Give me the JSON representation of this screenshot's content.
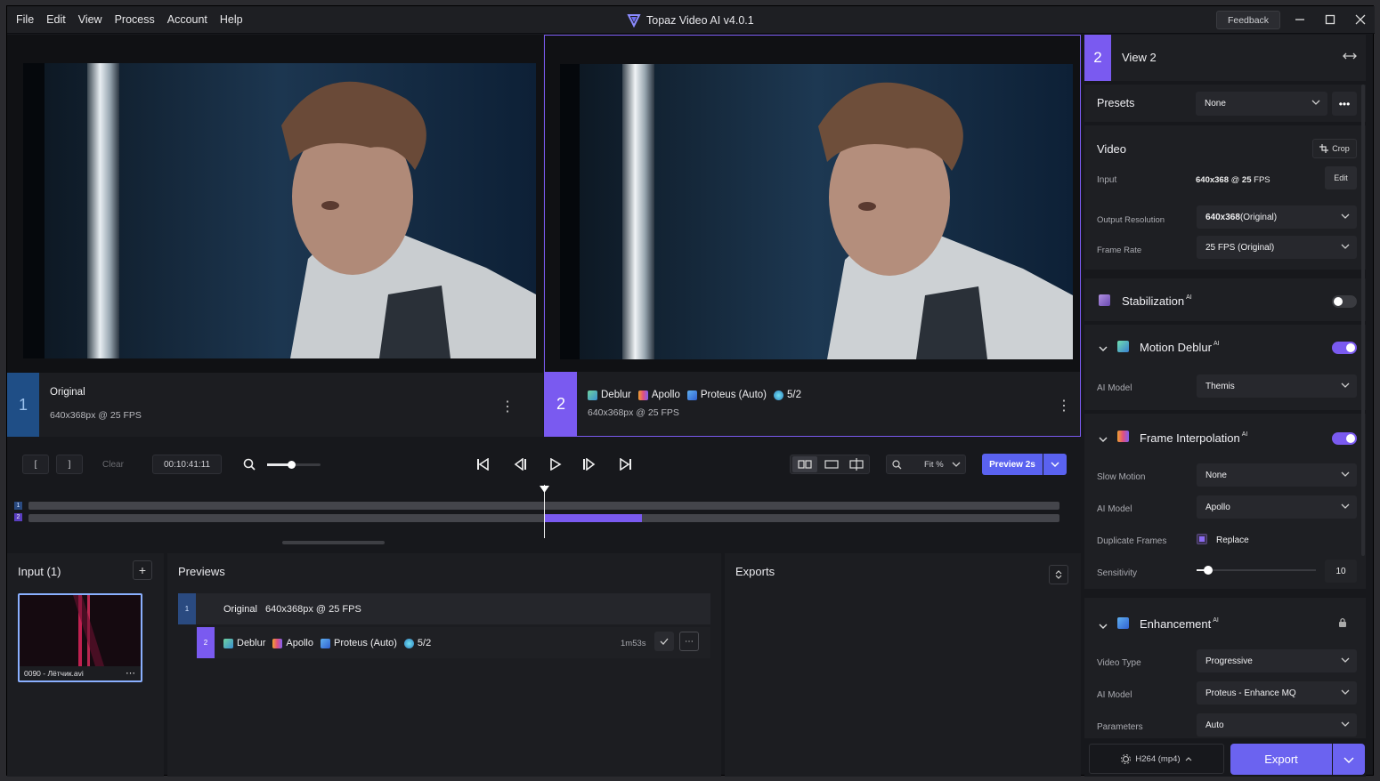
{
  "menu": [
    "File",
    "Edit",
    "View",
    "Process",
    "Account",
    "Help"
  ],
  "app_title": "Topaz Video AI  v4.0.1",
  "feedback_label": "Feedback",
  "viewer1": {
    "number": "1",
    "title": "Original",
    "meta": "640x368px @ 25 FPS"
  },
  "viewer2": {
    "number": "2",
    "tags": [
      "Deblur",
      "Apollo",
      "Proteus (Auto)",
      "5/2"
    ],
    "meta": "640x368px @ 25 FPS"
  },
  "transport": {
    "in_mark": "[",
    "out_mark": "]",
    "clear_label": "Clear",
    "timecode": "00:10:41:11",
    "fit_label": "Fit %",
    "preview_label": "Preview 2s",
    "track1": "1",
    "track2": "2",
    "zoom_level": 0.45,
    "playhead_fraction": 0.5,
    "preview_range": [
      0.5,
      0.595
    ]
  },
  "input_panel": {
    "title": "Input (1)",
    "file_name": "0090 - Лётчик.avi",
    "add_label": "+"
  },
  "previews_panel": {
    "title": "Previews",
    "rows": [
      {
        "number": "1",
        "name": "Original",
        "meta": "640x368px @ 25 FPS"
      },
      {
        "number": "2",
        "tags": [
          "Deblur",
          "Apollo",
          "Proteus (Auto)",
          "5/2"
        ],
        "duration": "1m53s"
      }
    ]
  },
  "exports_panel": {
    "title": "Exports"
  },
  "sidebar": {
    "view_number": "2",
    "view_title": "View 2",
    "presets_label": "Presets",
    "presets_value": "None",
    "video": {
      "title": "Video",
      "crop_label": "Crop",
      "input_label": "Input",
      "input_value_bold": "640x368",
      "input_value_at": " @ ",
      "input_value_fps_bold": "25",
      "input_value_fps": " FPS",
      "edit_label": "Edit",
      "output_res_label": "Output Resolution",
      "output_res_value_bold": "640x368",
      "output_res_value": " (Original)",
      "frame_rate_label": "Frame Rate",
      "frame_rate_value": "25 FPS (Original)"
    },
    "stabilization": {
      "title": "Stabilization",
      "ai": "AI",
      "enabled": false
    },
    "motion_deblur": {
      "title": "Motion Deblur",
      "ai": "AI",
      "enabled": true,
      "model_label": "AI Model",
      "model_value": "Themis"
    },
    "frame_interp": {
      "title": "Frame Interpolation",
      "ai": "AI",
      "enabled": true,
      "slow_motion_label": "Slow Motion",
      "slow_motion_value": "None",
      "model_label": "AI Model",
      "model_value": "Apollo",
      "dup_label": "Duplicate Frames",
      "dup_value": "Replace",
      "sens_label": "Sensitivity",
      "sens_value": "10"
    },
    "enhancement": {
      "title": "Enhancement",
      "ai": "AI",
      "video_type_label": "Video Type",
      "video_type_value": "Progressive",
      "model_label": "AI Model",
      "model_value": "Proteus - Enhance MQ",
      "params_label": "Parameters",
      "params_value": "Auto"
    },
    "format_label": "H264 (mp4)",
    "export_label": "Export"
  },
  "colors": {
    "accent": "#7a5af0",
    "export": "#6b63f0",
    "bg": "#17181c",
    "panel": "#1e1f23"
  }
}
